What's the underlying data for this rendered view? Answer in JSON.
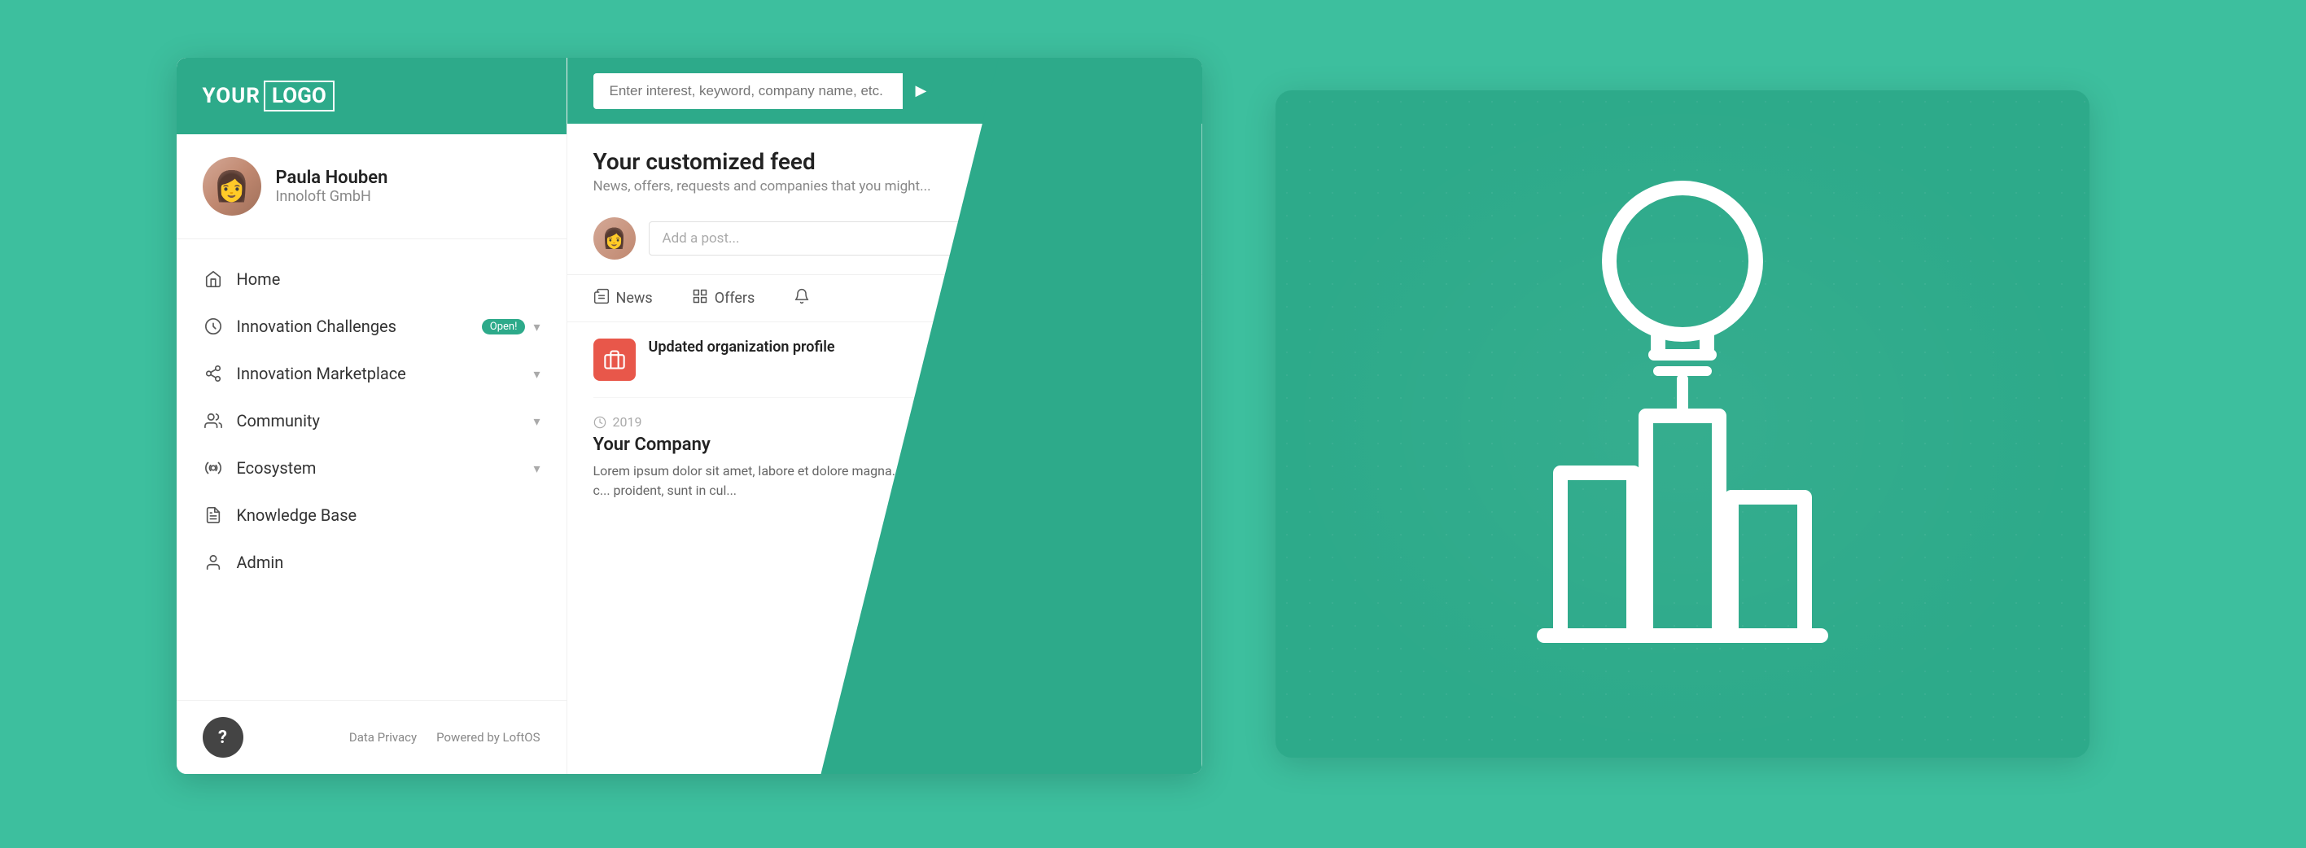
{
  "logo": {
    "text_before": "YOUR ",
    "text_box": "LOGO"
  },
  "user": {
    "name": "Paula Houben",
    "company": "Innoloft GmbH",
    "avatar_emoji": "👩"
  },
  "search": {
    "placeholder": "Enter interest, keyword, company name, etc."
  },
  "nav": {
    "items": [
      {
        "id": "home",
        "label": "Home",
        "icon": "🏠",
        "has_chevron": false,
        "badge": null
      },
      {
        "id": "innovation-challenges",
        "label": "Innovation Challenges",
        "icon": "🏆",
        "has_chevron": true,
        "badge": "Open!"
      },
      {
        "id": "innovation-marketplace",
        "label": "Innovation Marketplace",
        "icon": "🔀",
        "has_chevron": true,
        "badge": null
      },
      {
        "id": "community",
        "label": "Community",
        "icon": "👥",
        "has_chevron": true,
        "badge": null
      },
      {
        "id": "ecosystem",
        "label": "Ecosystem",
        "icon": "⚙️",
        "has_chevron": true,
        "badge": null
      },
      {
        "id": "knowledge-base",
        "label": "Knowledge Base",
        "icon": "📋",
        "has_chevron": false,
        "badge": null
      },
      {
        "id": "admin",
        "label": "Admin",
        "icon": "👤",
        "has_chevron": false,
        "badge": null
      }
    ]
  },
  "footer": {
    "links": [
      "Data Privacy",
      "Powered by LoftOS"
    ],
    "help_label": "?"
  },
  "feed": {
    "title": "Your customized feed",
    "subtitle": "News, offers, requests and companies that you might...",
    "post_placeholder": "Add a post...",
    "tabs": [
      {
        "id": "news",
        "label": "News",
        "icon": "📰"
      },
      {
        "id": "offers",
        "label": "Offers",
        "icon": "⊞"
      },
      {
        "id": "more",
        "label": "",
        "icon": "🔔"
      }
    ],
    "items": [
      {
        "id": "item-1",
        "icon": "🏢",
        "icon_bg": "#e8574a",
        "title": "Updated organization profile",
        "subtitle": ""
      }
    ],
    "company": {
      "year": "2019",
      "name": "Your Company",
      "description": "Lorem ipsum dolor sit amet, labore et dolore magna... laboris nisi ut aliquip c... voluptate velit esse c... proident, sunt in cul..."
    }
  },
  "illustration": {
    "alt": "Lightbulb and city buildings icon"
  }
}
